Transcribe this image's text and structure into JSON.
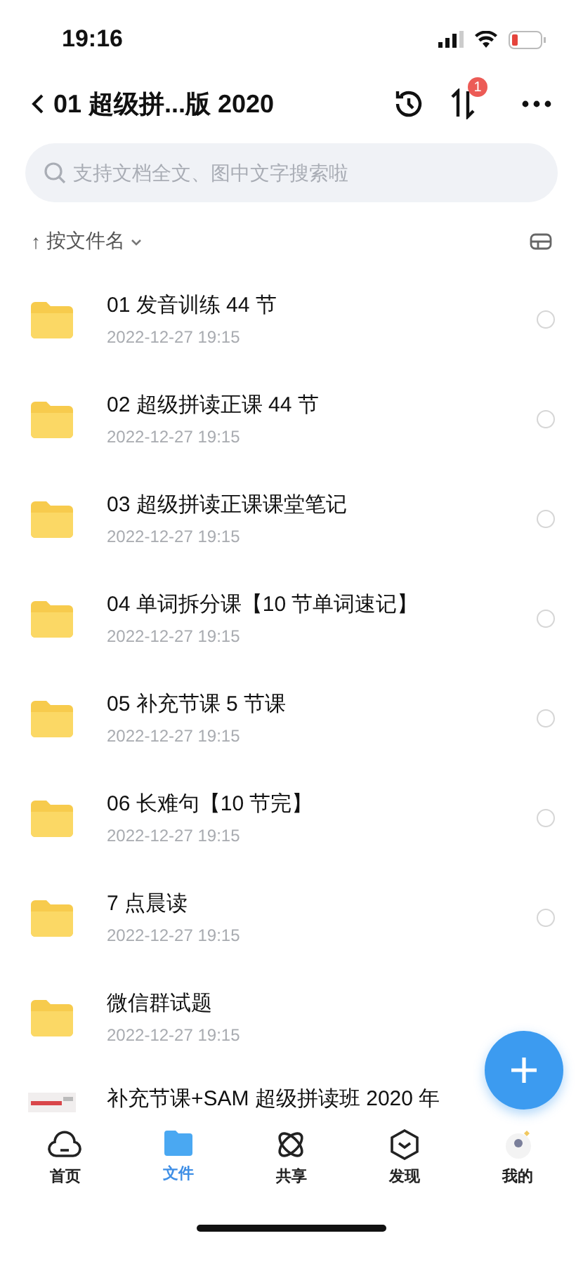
{
  "status_bar": {
    "time": "19:16"
  },
  "header": {
    "title": "01 超级拼...版 2020",
    "badge": "1"
  },
  "search": {
    "placeholder": "支持文档全文、图中文字搜索啦"
  },
  "sort": {
    "arrow": "↑",
    "label": "按文件名"
  },
  "files": [
    {
      "kind": "folder",
      "name": "01 发音训练 44 节",
      "date": "2022-12-27 19:15",
      "selected": false
    },
    {
      "kind": "folder",
      "name": "02 超级拼读正课 44 节",
      "date": "2022-12-27 19:15",
      "selected": false
    },
    {
      "kind": "folder",
      "name": "03 超级拼读正课课堂笔记",
      "date": "2022-12-27 19:15",
      "selected": false
    },
    {
      "kind": "folder",
      "name": "04 单词拆分课【10 节单词速记】",
      "date": "2022-12-27 19:15",
      "selected": false
    },
    {
      "kind": "folder",
      "name": "05 补充节课 5 节课",
      "date": "2022-12-27 19:15",
      "selected": false
    },
    {
      "kind": "folder",
      "name": "06 长难句【10 节完】",
      "date": "2022-12-27 19:15",
      "selected": false
    },
    {
      "kind": "folder",
      "name": "7 点晨读",
      "date": "2022-12-27 19:15",
      "selected": false
    },
    {
      "kind": "folder",
      "name": "微信群试题",
      "date": "2022-12-27 19:15"
    },
    {
      "kind": "picture",
      "name": "补充节课+SAM 超级拼读班 2020 年"
    }
  ],
  "tabs": [
    {
      "kind": "home",
      "label": "首页",
      "selected": false
    },
    {
      "kind": "files",
      "label": "文件",
      "selected": true
    },
    {
      "kind": "share",
      "label": "共享",
      "selected": false
    },
    {
      "kind": "discover",
      "label": "发现",
      "selected": false
    },
    {
      "kind": "avatar",
      "label": "我的",
      "selected": false
    }
  ]
}
